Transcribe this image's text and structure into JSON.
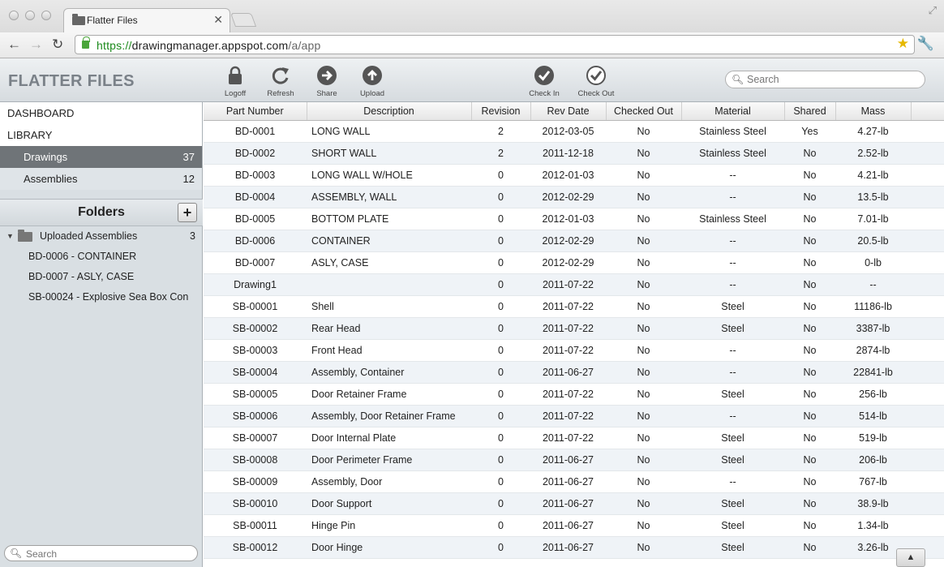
{
  "browser": {
    "tab_title": "Flatter Files",
    "url_scheme": "https://",
    "url_host": "drawingmanager.appspot.com",
    "url_path": "/a/app"
  },
  "header": {
    "brand": "FLATTER FILES",
    "buttons": {
      "logoff": "Logoff",
      "refresh": "Refresh",
      "share": "Share",
      "upload": "Upload",
      "check_in": "Check In",
      "check_out": "Check Out"
    },
    "search_placeholder": "Search"
  },
  "sidebar": {
    "dashboard": "DASHBOARD",
    "library": "LIBRARY",
    "items": [
      {
        "label": "Drawings",
        "count": "37"
      },
      {
        "label": "Assemblies",
        "count": "12"
      }
    ],
    "folders_title": "Folders",
    "add_label": "+",
    "tree": {
      "root": {
        "label": "Uploaded Assemblies",
        "count": "3"
      },
      "children": [
        "BD-0006 - CONTAINER",
        "BD-0007 - ASLY, CASE",
        "SB-00024 - Explosive Sea Box Con"
      ]
    },
    "search_placeholder": "Search"
  },
  "table": {
    "columns": [
      "Part Number",
      "Description",
      "Revision",
      "Rev Date",
      "Checked Out",
      "Material",
      "Shared",
      "Mass"
    ],
    "rows": [
      [
        "BD-0001",
        "LONG WALL",
        "2",
        "2012-03-05",
        "No",
        "Stainless Steel",
        "Yes",
        "4.27-lb"
      ],
      [
        "BD-0002",
        "SHORT WALL",
        "2",
        "2011-12-18",
        "No",
        "Stainless Steel",
        "No",
        "2.52-lb"
      ],
      [
        "BD-0003",
        "LONG WALL W/HOLE",
        "0",
        "2012-01-03",
        "No",
        "--",
        "No",
        "4.21-lb"
      ],
      [
        "BD-0004",
        "ASSEMBLY, WALL",
        "0",
        "2012-02-29",
        "No",
        "--",
        "No",
        "13.5-lb"
      ],
      [
        "BD-0005",
        "BOTTOM PLATE",
        "0",
        "2012-01-03",
        "No",
        "Stainless Steel",
        "No",
        "7.01-lb"
      ],
      [
        "BD-0006",
        "CONTAINER",
        "0",
        "2012-02-29",
        "No",
        "--",
        "No",
        "20.5-lb"
      ],
      [
        "BD-0007",
        "ASLY, CASE",
        "0",
        "2012-02-29",
        "No",
        "--",
        "No",
        "0-lb"
      ],
      [
        "Drawing1",
        "",
        "0",
        "2011-07-22",
        "No",
        "--",
        "No",
        "--"
      ],
      [
        "SB-00001",
        "Shell",
        "0",
        "2011-07-22",
        "No",
        "Steel",
        "No",
        "11186-lb"
      ],
      [
        "SB-00002",
        "Rear Head",
        "0",
        "2011-07-22",
        "No",
        "Steel",
        "No",
        "3387-lb"
      ],
      [
        "SB-00003",
        "Front Head",
        "0",
        "2011-07-22",
        "No",
        "--",
        "No",
        "2874-lb"
      ],
      [
        "SB-00004",
        "Assembly, Container",
        "0",
        "2011-06-27",
        "No",
        "--",
        "No",
        "22841-lb"
      ],
      [
        "SB-00005",
        "Door Retainer Frame",
        "0",
        "2011-07-22",
        "No",
        "Steel",
        "No",
        "256-lb"
      ],
      [
        "SB-00006",
        "Assembly, Door Retainer Frame",
        "0",
        "2011-07-22",
        "No",
        "--",
        "No",
        "514-lb"
      ],
      [
        "SB-00007",
        "Door Internal Plate",
        "0",
        "2011-07-22",
        "No",
        "Steel",
        "No",
        "519-lb"
      ],
      [
        "SB-00008",
        "Door Perimeter Frame",
        "0",
        "2011-06-27",
        "No",
        "Steel",
        "No",
        "206-lb"
      ],
      [
        "SB-00009",
        "Assembly, Door",
        "0",
        "2011-06-27",
        "No",
        "--",
        "No",
        "767-lb"
      ],
      [
        "SB-00010",
        "Door Support",
        "0",
        "2011-06-27",
        "No",
        "Steel",
        "No",
        "38.9-lb"
      ],
      [
        "SB-00011",
        "Hinge Pin",
        "0",
        "2011-06-27",
        "No",
        "Steel",
        "No",
        "1.34-lb"
      ],
      [
        "SB-00012",
        "Door Hinge",
        "0",
        "2011-06-27",
        "No",
        "Steel",
        "No",
        "3.26-lb"
      ]
    ],
    "scroll_top_label": "▲"
  }
}
